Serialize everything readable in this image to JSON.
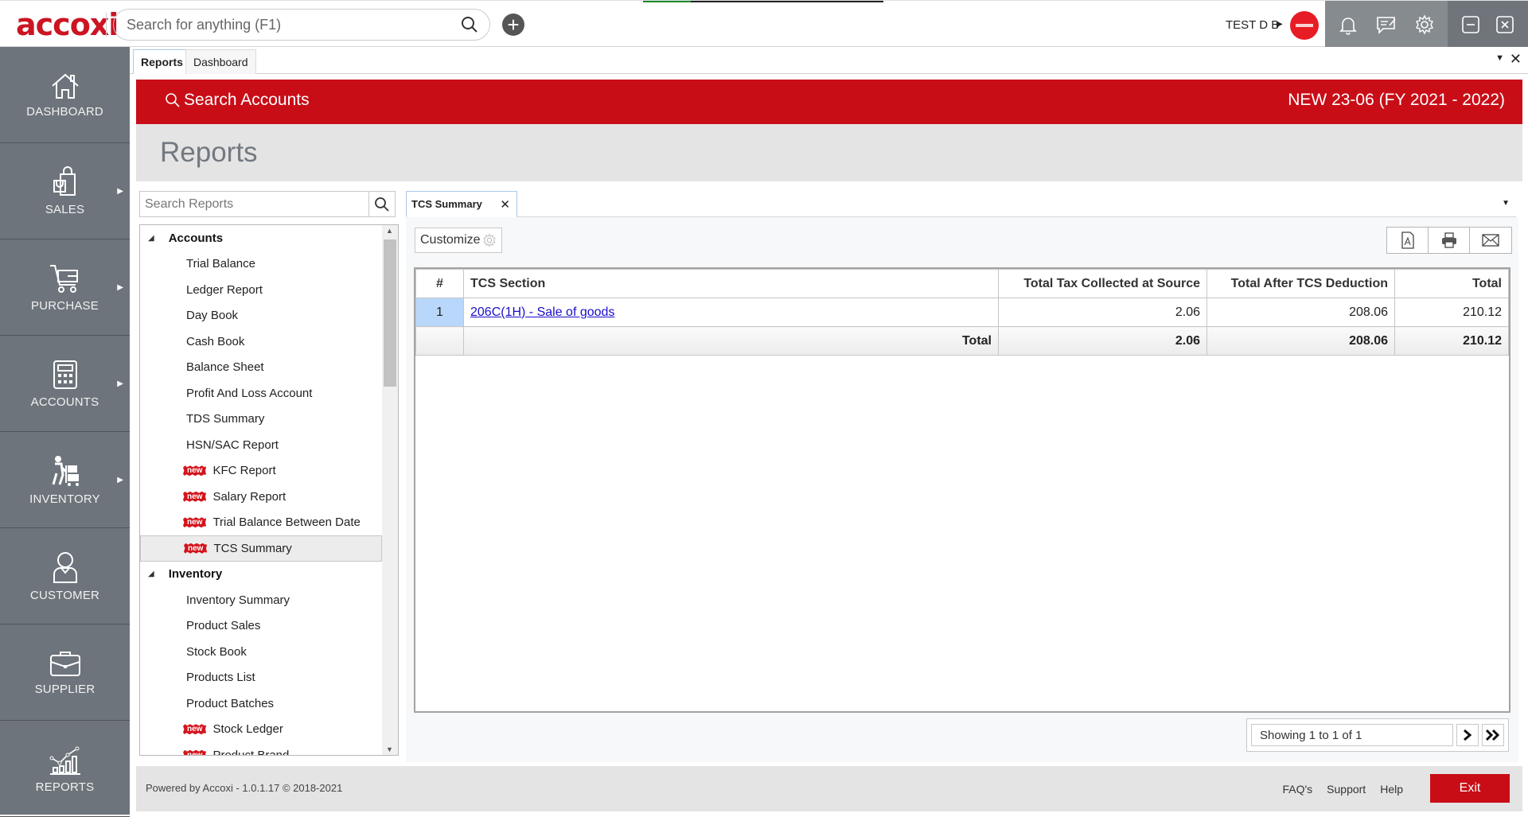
{
  "app": {
    "logo": "accoxi",
    "search_placeholder": "Search for anything (F1)",
    "user_name": "TEST D B",
    "page_load_progress_percent": 20
  },
  "sidebar": {
    "items": [
      {
        "label": "DASHBOARD",
        "icon": "home-icon",
        "has_submenu": false
      },
      {
        "label": "SALES",
        "icon": "shopping-bag-icon",
        "has_submenu": true
      },
      {
        "label": "PURCHASE",
        "icon": "cart-icon",
        "has_submenu": true
      },
      {
        "label": "ACCOUNTS",
        "icon": "calculator-icon",
        "has_submenu": true
      },
      {
        "label": "INVENTORY",
        "icon": "trolley-icon",
        "has_submenu": true
      },
      {
        "label": "CUSTOMER",
        "icon": "person-icon",
        "has_submenu": false
      },
      {
        "label": "SUPPLIER",
        "icon": "briefcase-icon",
        "has_submenu": false
      },
      {
        "label": "REPORTS",
        "icon": "chart-icon",
        "has_submenu": false
      }
    ]
  },
  "module_tabs": [
    {
      "label": "Reports",
      "active": true
    },
    {
      "label": "Dashboard",
      "active": false
    }
  ],
  "banner": {
    "search_accounts": "Search Accounts",
    "company": "NEW 23-06 (FY 2021 - 2022)"
  },
  "page_title": "Reports",
  "report_list": {
    "search_placeholder": "Search Reports",
    "groups": [
      {
        "label": "Accounts",
        "items": [
          {
            "label": "Trial Balance",
            "new": false
          },
          {
            "label": "Ledger Report",
            "new": false
          },
          {
            "label": "Day Book",
            "new": false
          },
          {
            "label": "Cash Book",
            "new": false
          },
          {
            "label": "Balance Sheet",
            "new": false
          },
          {
            "label": "Profit And Loss Account",
            "new": false
          },
          {
            "label": "TDS Summary",
            "new": false
          },
          {
            "label": "HSN/SAC Report",
            "new": false
          },
          {
            "label": "KFC Report",
            "new": true
          },
          {
            "label": "Salary Report",
            "new": true
          },
          {
            "label": "Trial Balance Between Date",
            "new": true
          },
          {
            "label": "TCS Summary",
            "new": true,
            "selected": true
          }
        ]
      },
      {
        "label": "Inventory",
        "items": [
          {
            "label": "Inventory Summary",
            "new": false
          },
          {
            "label": "Product Sales",
            "new": false
          },
          {
            "label": "Stock Book",
            "new": false
          },
          {
            "label": "Products List",
            "new": false
          },
          {
            "label": "Product Batches",
            "new": false
          },
          {
            "label": "Stock Ledger",
            "new": true
          },
          {
            "label": "Product Brand",
            "new": true
          }
        ]
      }
    ],
    "new_badge_label": "new"
  },
  "report_tab": {
    "label": "TCS Summary",
    "customize_label": "Customize"
  },
  "table": {
    "columns": [
      "#",
      "TCS Section",
      "Total Tax Collected at Source",
      "Total After TCS Deduction",
      "Total"
    ],
    "rows": [
      {
        "no": "1",
        "section": "206C(1H) - Sale of goods",
        "tcs": "2.06",
        "after": "208.06",
        "total": "210.12"
      }
    ],
    "totals": {
      "label": "Total",
      "tcs": "2.06",
      "after": "208.06",
      "total": "210.12"
    }
  },
  "pager": {
    "info": "Showing 1 to 1 of 1",
    "next": "›",
    "last": "»"
  },
  "footer": {
    "powered": "Powered by Accoxi - 1.0.1.17 © 2018-2021",
    "links": [
      "FAQ's",
      "Support",
      "Help"
    ],
    "exit": "Exit"
  }
}
